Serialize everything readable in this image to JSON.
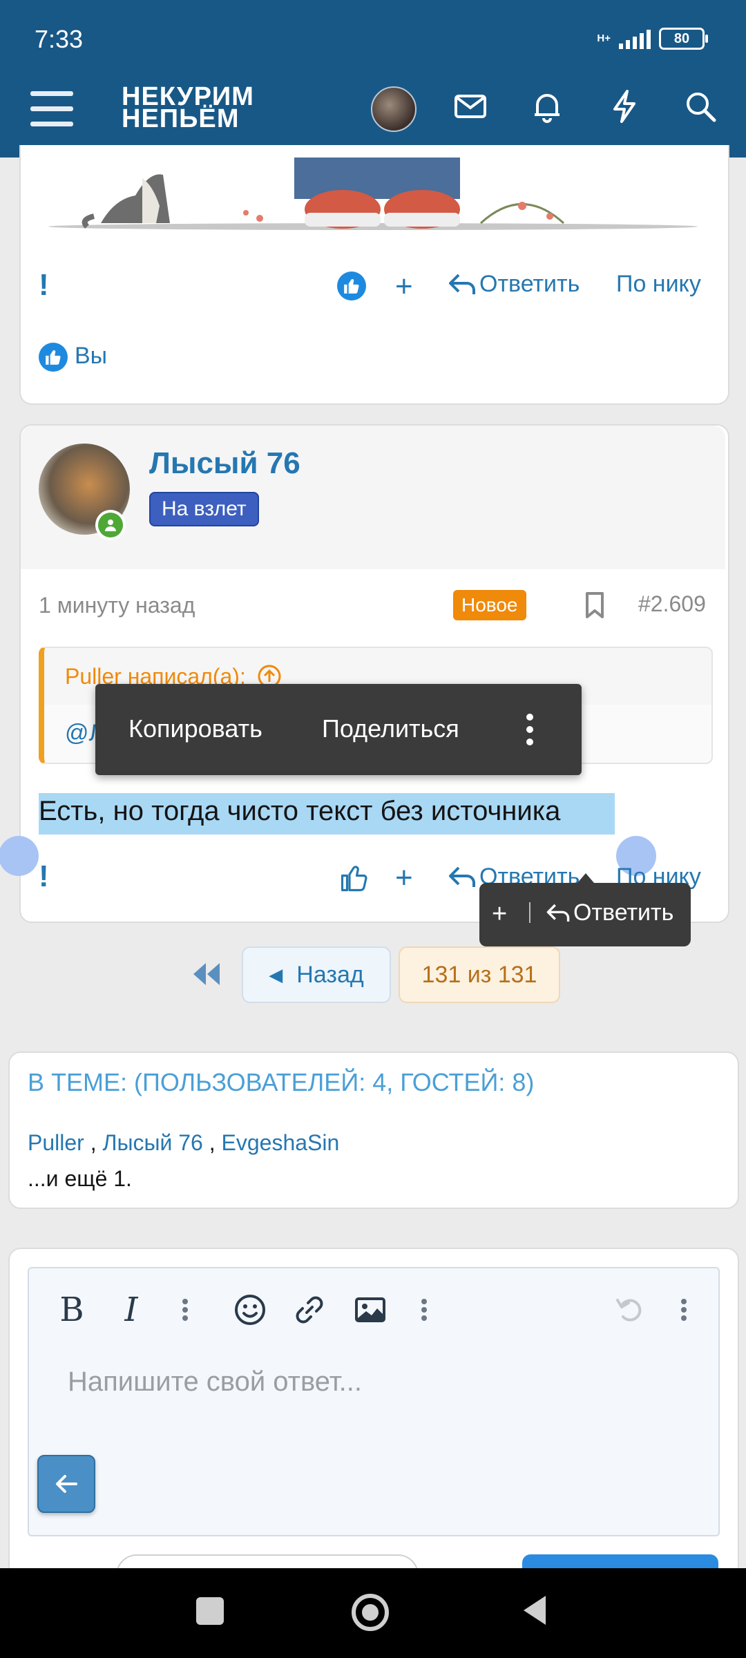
{
  "status": {
    "time": "7:33",
    "network": "H+",
    "battery": "80"
  },
  "header": {
    "logo_line1": "НЕКУРИМ",
    "logo_line2": "НЕПЬЁМ"
  },
  "post1": {
    "reply": "Ответить",
    "by_nick": "По нику",
    "reaction_user": "Вы"
  },
  "post2": {
    "author": "Лысый 76",
    "rank": "На взлет",
    "time": "1 минуту назад",
    "new_badge": "Новое",
    "number": "#2.609",
    "quote_author": "Puller написал(а):",
    "quote_text": "@Л",
    "body": "Есть, но тогда чисто текст без источника",
    "reply": "Ответить",
    "by_nick": "По нику"
  },
  "context_menu": {
    "copy": "Копировать",
    "share": "Поделиться"
  },
  "mini_menu": {
    "plus": "+",
    "reply": "Ответить"
  },
  "pagination": {
    "back": "Назад",
    "current": "131 из 131"
  },
  "online": {
    "title": "В ТЕМЕ: (ПОЛЬЗОВАТЕЛЕЙ: 4, ГОСТЕЙ: 8)",
    "users": [
      "Puller",
      "Лысый 76",
      "EvgeshaSin"
    ],
    "more": "...и ещё 1."
  },
  "editor": {
    "placeholder": "Напишите свой ответ..."
  },
  "colors": {
    "header": "#185886",
    "link": "#2577b1",
    "accent_orange": "#f08a0a",
    "selection": "#a9d8f4"
  }
}
